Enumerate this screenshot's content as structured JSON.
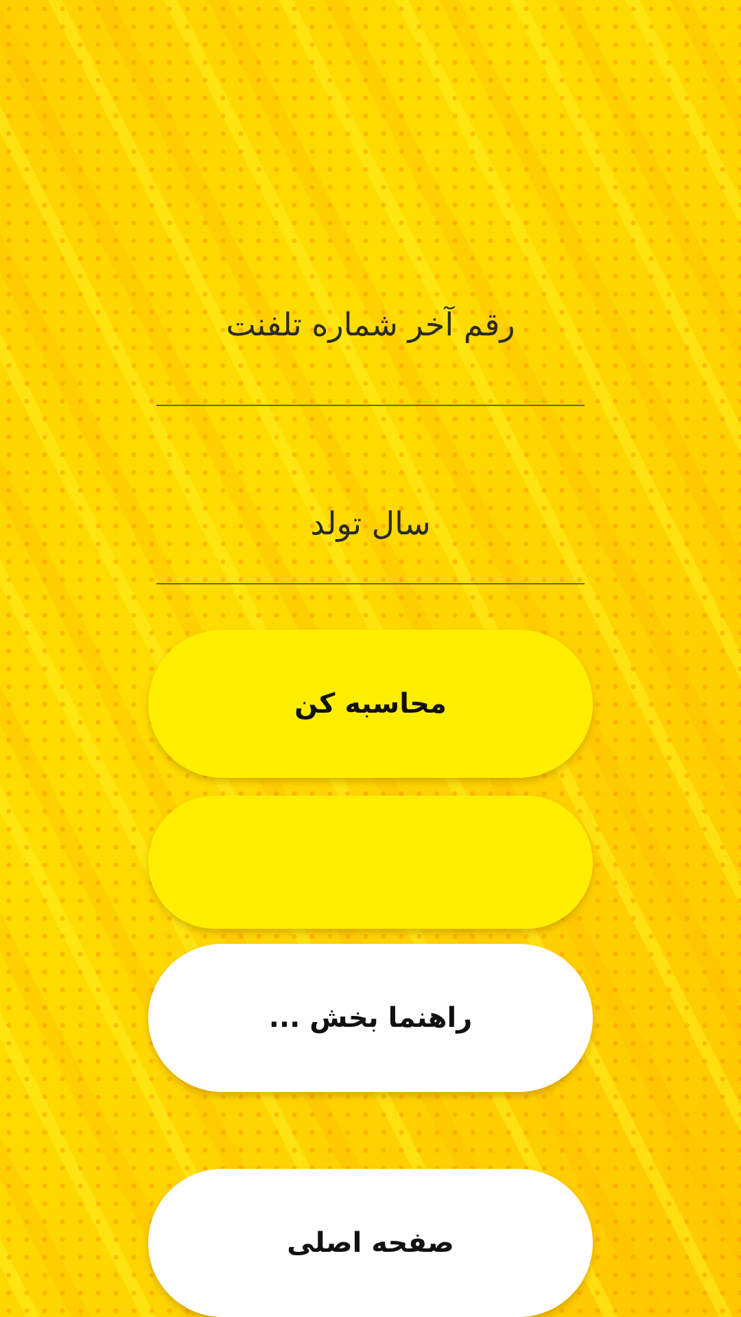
{
  "form": {
    "phone_digit_placeholder": "رقم آخر شماره تلفنت",
    "birth_year_placeholder": "سال تولد"
  },
  "buttons": {
    "calculate_label": "محاسبه کن",
    "result_label": "",
    "help_label": "راهنما بخش ...",
    "home_label": "صفحه اصلی"
  },
  "colors": {
    "background": "#FFD500",
    "primary_button": "#FFEE00",
    "secondary_button": "#FFFFFF"
  }
}
